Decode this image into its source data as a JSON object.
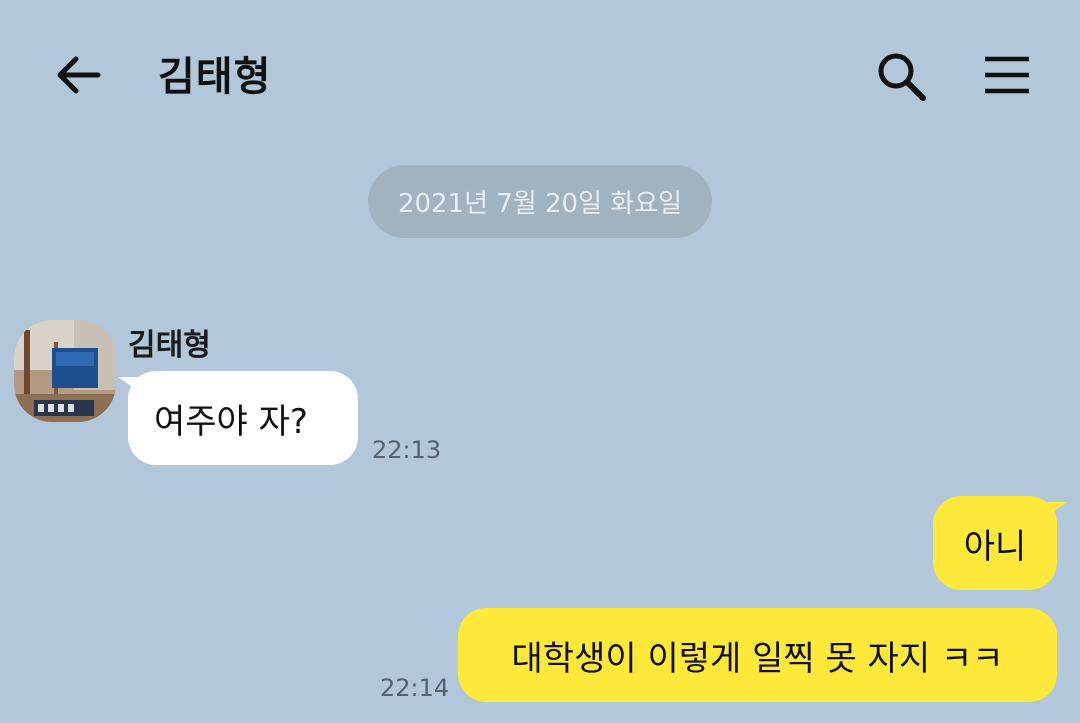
{
  "header": {
    "title": "김태형",
    "back_icon": "arrow-left-icon",
    "search_icon": "search-icon",
    "menu_icon": "hamburger-menu-icon"
  },
  "date_divider": "2021년 7월 20일 화요일",
  "messages": [
    {
      "direction": "in",
      "sender": "김태형",
      "text": "여주야 자?",
      "time": "22:13"
    },
    {
      "direction": "out",
      "text": "아니",
      "time": ""
    },
    {
      "direction": "out",
      "text": "대학생이 이렇게 일찍 못 자지 ㅋㅋ",
      "time": "22:14"
    }
  ],
  "colors": {
    "background": "#b2c7da",
    "incoming_bubble": "#ffffff",
    "outgoing_bubble": "#fee93b",
    "date_pill": "#a1b2c1"
  }
}
